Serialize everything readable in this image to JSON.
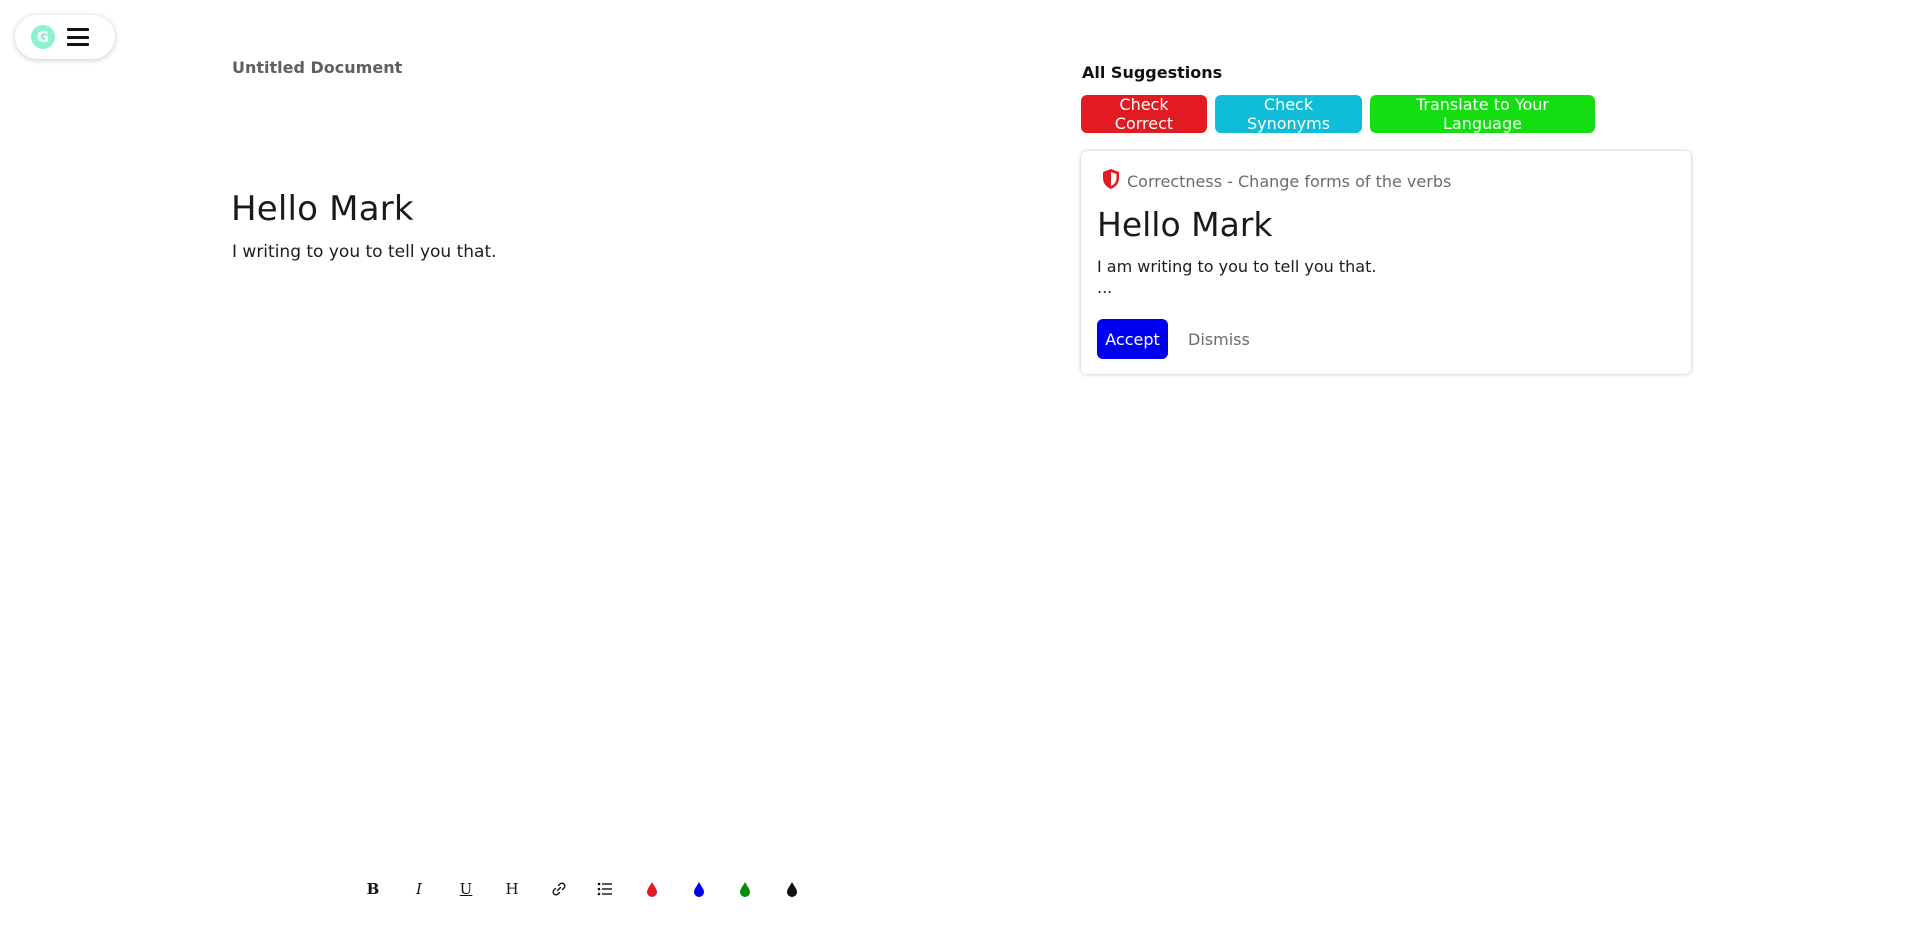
{
  "header": {
    "logo_letter": "G",
    "logo_color": "#8ff2cf"
  },
  "document": {
    "title": "Untitled Document",
    "heading": "Hello Mark",
    "body": "I writing to you to tell you that."
  },
  "suggestions": {
    "title": "All Suggestions",
    "buttons": [
      {
        "label": "Check Correct",
        "color": "#e21b23"
      },
      {
        "label": "Check Synonyms",
        "color": "#10bdd8"
      },
      {
        "label": "Translate to Your Language",
        "color": "#14de12"
      }
    ],
    "card": {
      "category": "Correctness - Change forms of the verbs",
      "icon": "shield-icon",
      "heading": "Hello Mark",
      "text": "I am writing to you to tell you that.",
      "ellipsis": "...",
      "accept_label": "Accept",
      "dismiss_label": "Dismiss",
      "accept_color": "#0000f0"
    }
  },
  "toolbar": {
    "bold": "B",
    "italic": "I",
    "underline": "U",
    "heading": "H",
    "icons": [
      "bold-icon",
      "italic-icon",
      "underline-icon",
      "heading-icon",
      "link-icon",
      "list-icon",
      "color-red-icon",
      "color-blue-icon",
      "color-green-icon",
      "color-black-icon"
    ],
    "colors": [
      "#e21b23",
      "#0000f0",
      "#0a8a0a",
      "#111111"
    ]
  }
}
